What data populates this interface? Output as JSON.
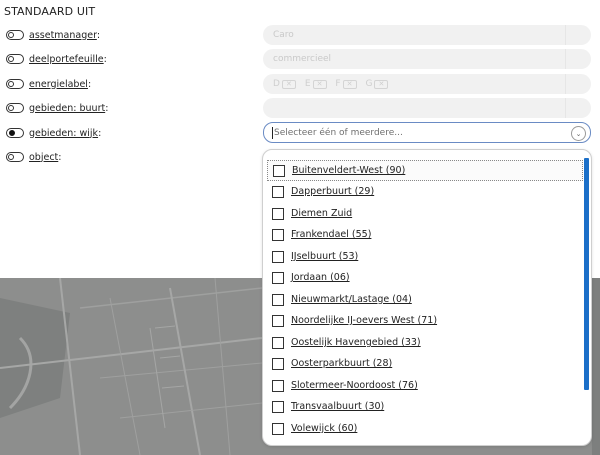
{
  "section": {
    "title": "STANDAARD UIT"
  },
  "filters": [
    {
      "label": "assetmanager",
      "suffix": ":",
      "on": false
    },
    {
      "label": "deelportefeuille",
      "suffix": ":",
      "on": false
    },
    {
      "label": "energielabel",
      "suffix": ":",
      "on": false
    },
    {
      "label": "gebieden: buurt",
      "suffix": ":",
      "on": false
    },
    {
      "label": "gebieden: wijk",
      "suffix": ":",
      "on": true
    },
    {
      "label": "object",
      "suffix": ":",
      "on": false
    }
  ],
  "fields": {
    "assetmanager": {
      "value": "Caro"
    },
    "deelportefeuille": {
      "value": "commercieel"
    },
    "energielabel": {
      "chips": [
        "D",
        "E",
        "F",
        "G"
      ]
    },
    "wijk": {
      "placeholder": "Selecteer één of meerdere..."
    }
  },
  "dropdown": {
    "options": [
      "Buitenveldert-West (90)",
      "Dapperbuurt (29)",
      "Diemen Zuid",
      "Frankendael (55)",
      "IJselbuurt (53)",
      "Jordaan (06)",
      "Nieuwmarkt/Lastage (04)",
      "Noordelijke IJ-oevers West (71)",
      "Oostelijk Havengebied (33)",
      "Oosterparkbuurt (28)",
      "Slotermeer-Noordoost (76)",
      "Transvaalbuurt (30)",
      "Volewijck (60)"
    ]
  },
  "colors": {
    "accent": "#1b6fc8",
    "focus_border": "#6a8bc4",
    "map": "#8f908f"
  }
}
